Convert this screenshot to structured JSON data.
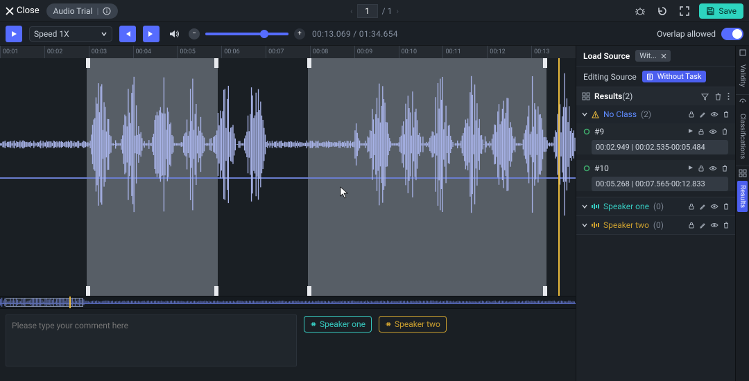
{
  "header": {
    "close": "Close",
    "title": "Audio Trial",
    "page": "1",
    "total": "/ 1",
    "save": "Save"
  },
  "controls": {
    "speed": "Speed 1X",
    "time_current": "00:13.069",
    "time_sep": " / ",
    "time_total": "01:34.654",
    "overlap_label": "Overlap allowed"
  },
  "ruler": [
    "00:01",
    "00:02",
    "00:03",
    "00:04",
    "00:05",
    "00:06",
    "00:07",
    "00:08",
    "00:09",
    "00:10",
    "00:11",
    "00:12",
    "00:13"
  ],
  "bottom": {
    "comment_ph": "Please type your comment here",
    "tags": [
      {
        "label": "Speaker one",
        "class": "cyan"
      },
      {
        "label": "Speaker two",
        "class": "gold"
      }
    ]
  },
  "panel": {
    "load_label": "Load Source",
    "load_chip_text": "Wit...",
    "edit_label": "Editing Source",
    "edit_chip": "Without Task",
    "results_title": "Results",
    "results_count": "(2)",
    "groups": [
      {
        "title": "No Class",
        "count": "(2)",
        "kind": "warn",
        "items": [
          {
            "id": "#9",
            "time": "00:02.949 | 00:02.535-00:05.484"
          },
          {
            "id": "#10",
            "time": "00:05.268 | 00:07.565-00:12.833"
          }
        ]
      },
      {
        "title": "Speaker one",
        "count": "(0)",
        "kind": "sp1",
        "items": []
      },
      {
        "title": "Speaker two",
        "count": "(0)",
        "kind": "sp2",
        "items": []
      }
    ],
    "side_tabs": [
      "Validity",
      "Classifications",
      "Results"
    ]
  },
  "regions": [
    {
      "start_pct": 15.0,
      "end_pct": 37.8
    },
    {
      "start_pct": 53.5,
      "end_pct": 95.0
    }
  ],
  "playhead_pct": 97.0,
  "mini": {
    "win_start": 1,
    "win_end": 14.5,
    "cursor": 12.0
  }
}
